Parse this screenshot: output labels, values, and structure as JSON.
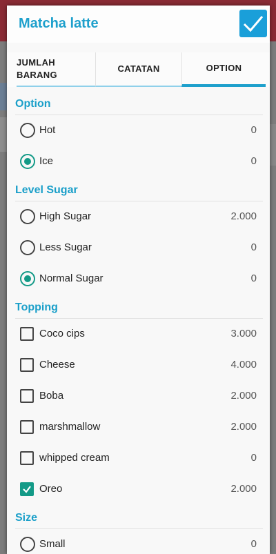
{
  "dialog": {
    "title": "Matcha latte"
  },
  "tabs": [
    {
      "label_line1": "JUMLAH",
      "label_line2": "BARANG"
    },
    {
      "label": "CATATAN"
    },
    {
      "label": "OPTION"
    }
  ],
  "sections": {
    "option": {
      "title": "Option",
      "items": [
        {
          "label": "Hot",
          "price": "0",
          "selected": false
        },
        {
          "label": "Ice",
          "price": "0",
          "selected": true
        }
      ]
    },
    "level_sugar": {
      "title": "Level Sugar",
      "items": [
        {
          "label": "High Sugar",
          "price": "2.000",
          "selected": false
        },
        {
          "label": "Less Sugar",
          "price": "0",
          "selected": false
        },
        {
          "label": "Normal Sugar",
          "price": "0",
          "selected": true
        }
      ]
    },
    "topping": {
      "title": "Topping",
      "items": [
        {
          "label": "Coco cips",
          "price": "3.000",
          "checked": false
        },
        {
          "label": "Cheese",
          "price": "4.000",
          "checked": false
        },
        {
          "label": "Boba",
          "price": "2.000",
          "checked": false
        },
        {
          "label": "marshmallow",
          "price": "2.000",
          "checked": false
        },
        {
          "label": "whipped cream",
          "price": "0",
          "checked": false
        },
        {
          "label": "Oreo",
          "price": "2.000",
          "checked": true
        }
      ]
    },
    "size": {
      "title": "Size",
      "items": [
        {
          "label": "Small",
          "price": "0",
          "selected": false
        }
      ]
    }
  },
  "colors": {
    "accent": "#1ea0cc",
    "selected": "#139a87",
    "confirm_button": "#1a9fd9"
  },
  "icons": {
    "confirm": "check-icon"
  }
}
